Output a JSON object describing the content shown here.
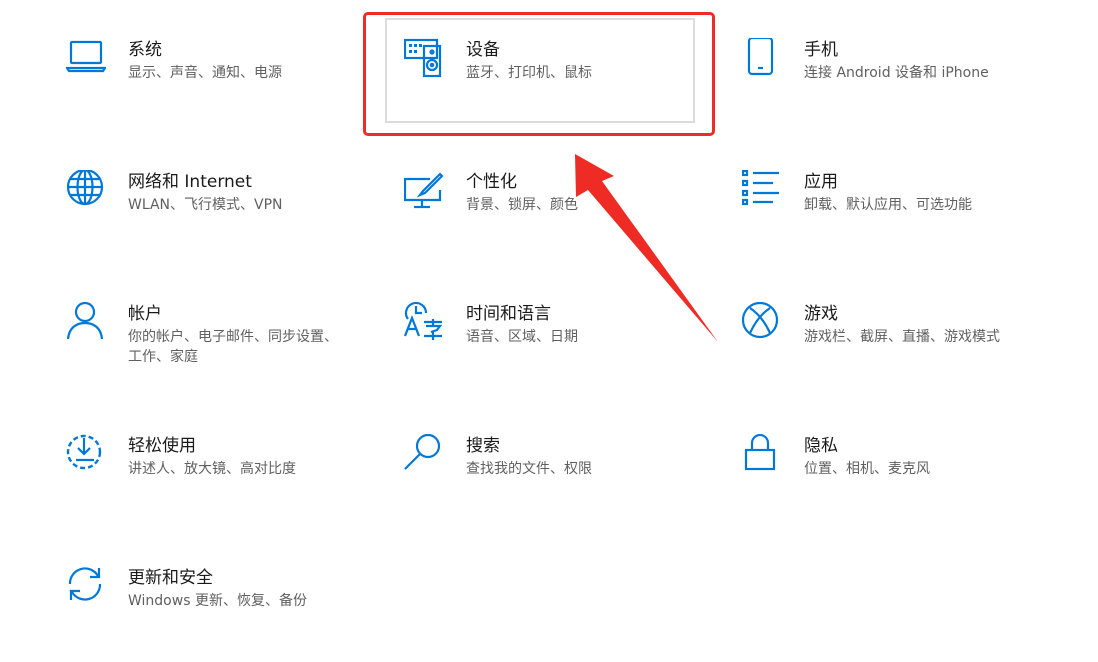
{
  "colors": {
    "accent": "#0078d7",
    "annotation": "#ee2b24"
  },
  "tiles": [
    {
      "icon": "laptop-icon",
      "title": "系统",
      "desc": "显示、声音、通知、电源"
    },
    {
      "icon": "keyboard-speaker-icon",
      "title": "设备",
      "desc": "蓝牙、打印机、鼠标"
    },
    {
      "icon": "phone-icon",
      "title": "手机",
      "desc": "连接 Android 设备和 iPhone"
    },
    {
      "icon": "globe-icon",
      "title": "网络和 Internet",
      "desc": "WLAN、飞行模式、VPN"
    },
    {
      "icon": "monitor-brush-icon",
      "title": "个性化",
      "desc": "背景、锁屏、颜色"
    },
    {
      "icon": "apps-list-icon",
      "title": "应用",
      "desc": "卸载、默认应用、可选功能"
    },
    {
      "icon": "person-icon",
      "title": "帐户",
      "desc": "你的帐户、电子邮件、同步设置、工作、家庭"
    },
    {
      "icon": "time-language-icon",
      "title": "时间和语言",
      "desc": "语音、区域、日期"
    },
    {
      "icon": "xbox-icon",
      "title": "游戏",
      "desc": "游戏栏、截屏、直播、游戏模式"
    },
    {
      "icon": "ease-of-access-icon",
      "title": "轻松使用",
      "desc": "讲述人、放大镜、高对比度"
    },
    {
      "icon": "search-icon",
      "title": "搜索",
      "desc": "查找我的文件、权限"
    },
    {
      "icon": "lock-icon",
      "title": "隐私",
      "desc": "位置、相机、麦克风"
    },
    {
      "icon": "update-sync-icon",
      "title": "更新和安全",
      "desc": "Windows 更新、恢复、备份"
    }
  ]
}
